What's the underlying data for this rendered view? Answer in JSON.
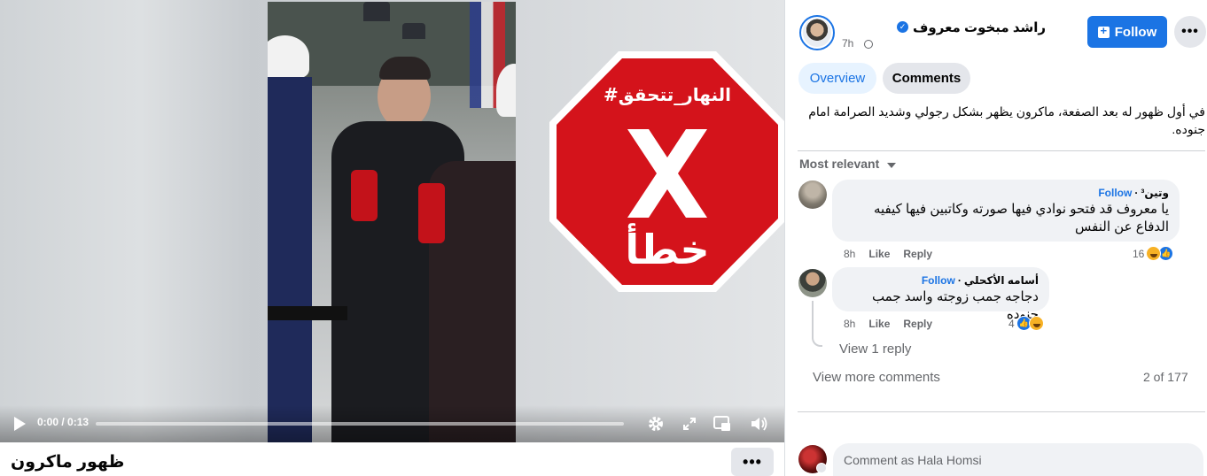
{
  "video": {
    "time": "0:00 / 0:13",
    "progress": 0,
    "overlay_hashtag": "#النهار_تتحقق",
    "overlay_verdict": "خطأ",
    "badge_color": "#d4131b"
  },
  "post": {
    "title": "ظهور ماكرون",
    "author": "راشد مبخوت معروف",
    "time": "7h",
    "follow_label": "Follow",
    "caption": "في أول ظهور له بعد الصفعة، ماكرون يظهر بشكل رجولي وشديد الصرامة امام جنوده."
  },
  "tabs": [
    {
      "label": "Overview",
      "active": false
    },
    {
      "label": "Comments",
      "active": true
    }
  ],
  "sort_label": "Most relevant",
  "comments": [
    {
      "author": "وتين³‎",
      "follow": "Follow",
      "text": "يا معروف قد فتحو نوادي فيها صورته وكاتبين فيها كيفيه الدفاع عن النفس",
      "time": "8h",
      "like": "Like",
      "reply": "Reply",
      "reactions": "16"
    },
    {
      "author": "أسامه الأكحلي",
      "follow": "Follow",
      "text": "دجاجه جمب زوجته واسد جمب جنوده",
      "time": "8h",
      "like": "Like",
      "reply": "Reply",
      "reactions": "4"
    }
  ],
  "view_reply": "View 1 reply",
  "view_more": "View more comments",
  "comment_count": "2 of 177",
  "composer_placeholder": "Comment as Hala Homsi",
  "colors": {
    "accent": "#1b74e4",
    "bubble": "#f0f2f5",
    "muted": "#65676b"
  }
}
